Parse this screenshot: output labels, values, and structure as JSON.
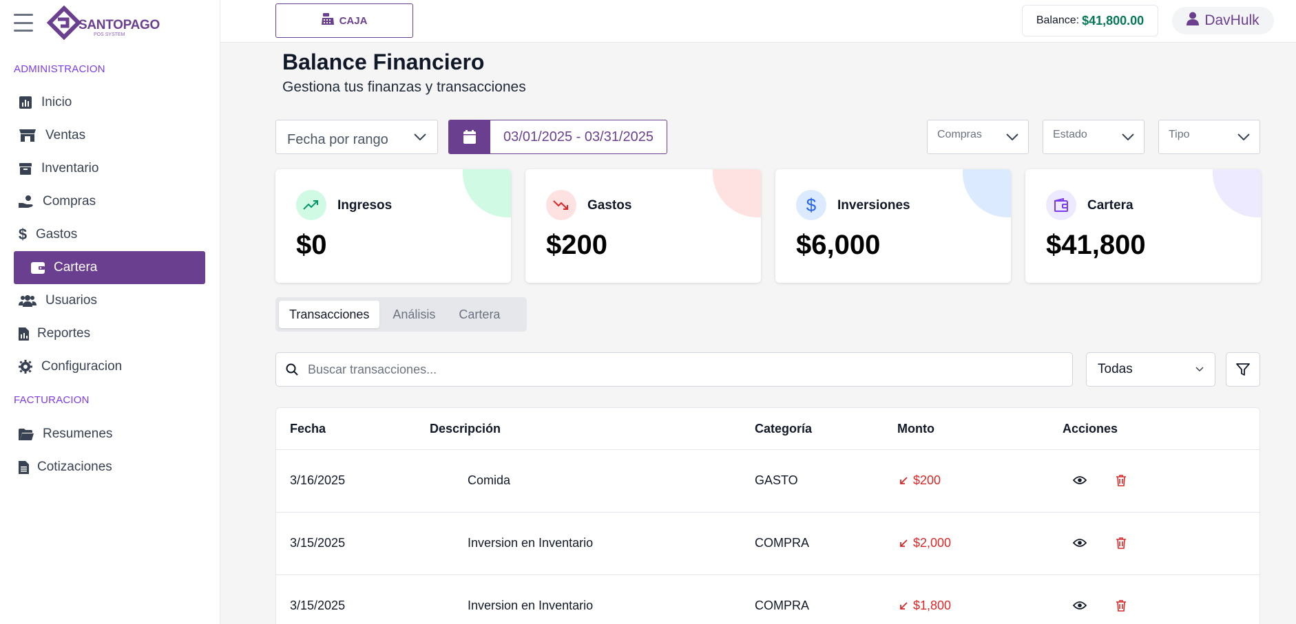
{
  "brand": {
    "name": "SANTOPAGO",
    "sub": "POS SYSTEM",
    "color": "#6b3f8f"
  },
  "sidebar": {
    "sections": {
      "admin": "ADMINISTRACION",
      "billing": "FACTURACION"
    },
    "admin_items": [
      {
        "label": "Inicio",
        "icon": "chart-icon"
      },
      {
        "label": "Ventas",
        "icon": "store-icon"
      },
      {
        "label": "Inventario",
        "icon": "box-icon"
      },
      {
        "label": "Compras",
        "icon": "hand-money-icon"
      },
      {
        "label": "Gastos",
        "icon": "dollar-icon"
      },
      {
        "label": "Cartera",
        "icon": "wallet-icon",
        "active": true
      },
      {
        "label": "Usuarios",
        "icon": "users-icon"
      },
      {
        "label": "Reportes",
        "icon": "report-icon"
      },
      {
        "label": "Configuracion",
        "icon": "gear-icon"
      }
    ],
    "billing_items": [
      {
        "label": "Resumenes",
        "icon": "folder-icon"
      },
      {
        "label": "Cotizaciones",
        "icon": "document-icon"
      }
    ]
  },
  "topbar": {
    "caja_label": "CAJA",
    "balance_label": "Balance:",
    "balance_value": "$41,800.00",
    "user_name": "DavHulk"
  },
  "header": {
    "title": "Balance Financiero",
    "subtitle": "Gestiona tus finanzas y transacciones"
  },
  "filters": {
    "range_select": "Fecha por rango",
    "date_range": "03/01/2025 - 03/31/2025",
    "compras": "Compras",
    "estado": "Estado",
    "tipo": "Tipo"
  },
  "cards": [
    {
      "label": "Ingresos",
      "value": "$0",
      "icon": "trend-up-icon",
      "accent": "#059669",
      "bg": "#d1fae5"
    },
    {
      "label": "Gastos",
      "value": "$200",
      "icon": "trend-down-icon",
      "accent": "#dc2626",
      "bg": "#fee2e2"
    },
    {
      "label": "Inversiones",
      "value": "$6,000",
      "icon": "dollar-icon",
      "accent": "#2563eb",
      "bg": "#dbeafe"
    },
    {
      "label": "Cartera",
      "value": "$41,800",
      "icon": "wallet-icon",
      "accent": "#7c3aed",
      "bg": "#ede9fe"
    }
  ],
  "tabs": [
    {
      "label": "Transacciones",
      "active": true
    },
    {
      "label": "Análisis"
    },
    {
      "label": "Cartera"
    }
  ],
  "search": {
    "placeholder": "Buscar transacciones..."
  },
  "type_filter": "Todas",
  "table": {
    "columns": [
      "Fecha",
      "Descripción",
      "Categoría",
      "Monto",
      "Acciones"
    ],
    "rows": [
      {
        "fecha": "3/16/2025",
        "descripcion": "Comida",
        "categoria": "GASTO",
        "monto": "$200"
      },
      {
        "fecha": "3/15/2025",
        "descripcion": "Inversion en Inventario",
        "categoria": "COMPRA",
        "monto": "$2,000"
      },
      {
        "fecha": "3/15/2025",
        "descripcion": "Inversion en Inventario",
        "categoria": "COMPRA",
        "monto": "$1,800"
      }
    ]
  }
}
